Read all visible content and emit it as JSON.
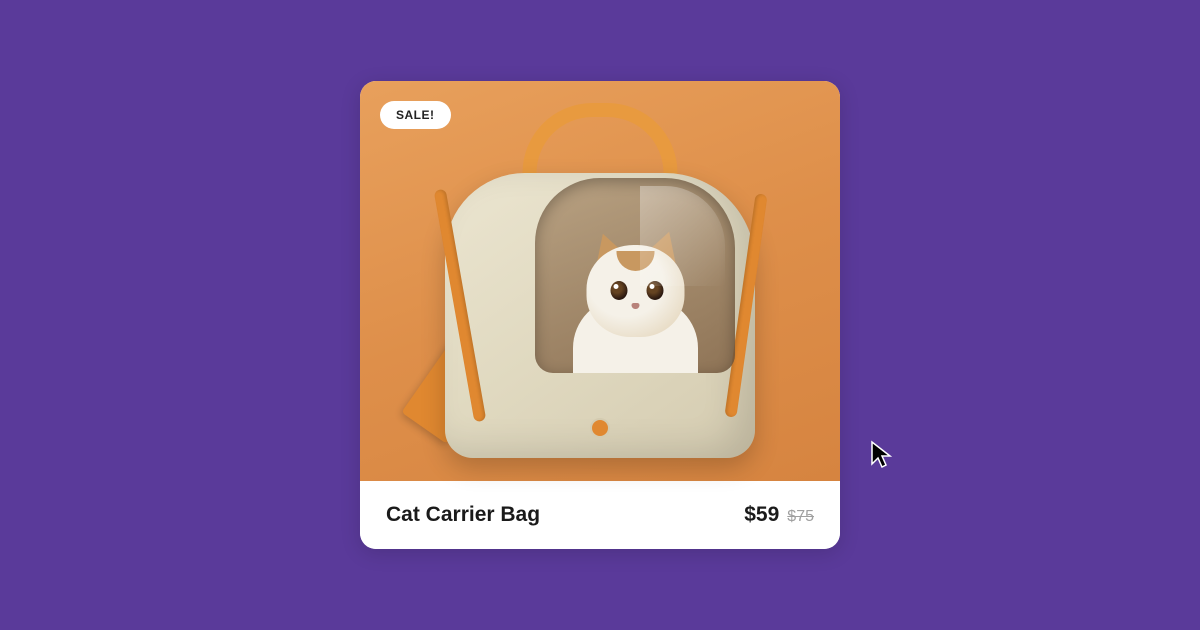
{
  "product": {
    "badge": "SALE!",
    "title": "Cat Carrier Bag",
    "price_current": "$59",
    "price_was": "$75"
  },
  "colors": {
    "background": "#5a3a9a",
    "image_bg": "#e8a05c",
    "accent": "#e08830"
  }
}
